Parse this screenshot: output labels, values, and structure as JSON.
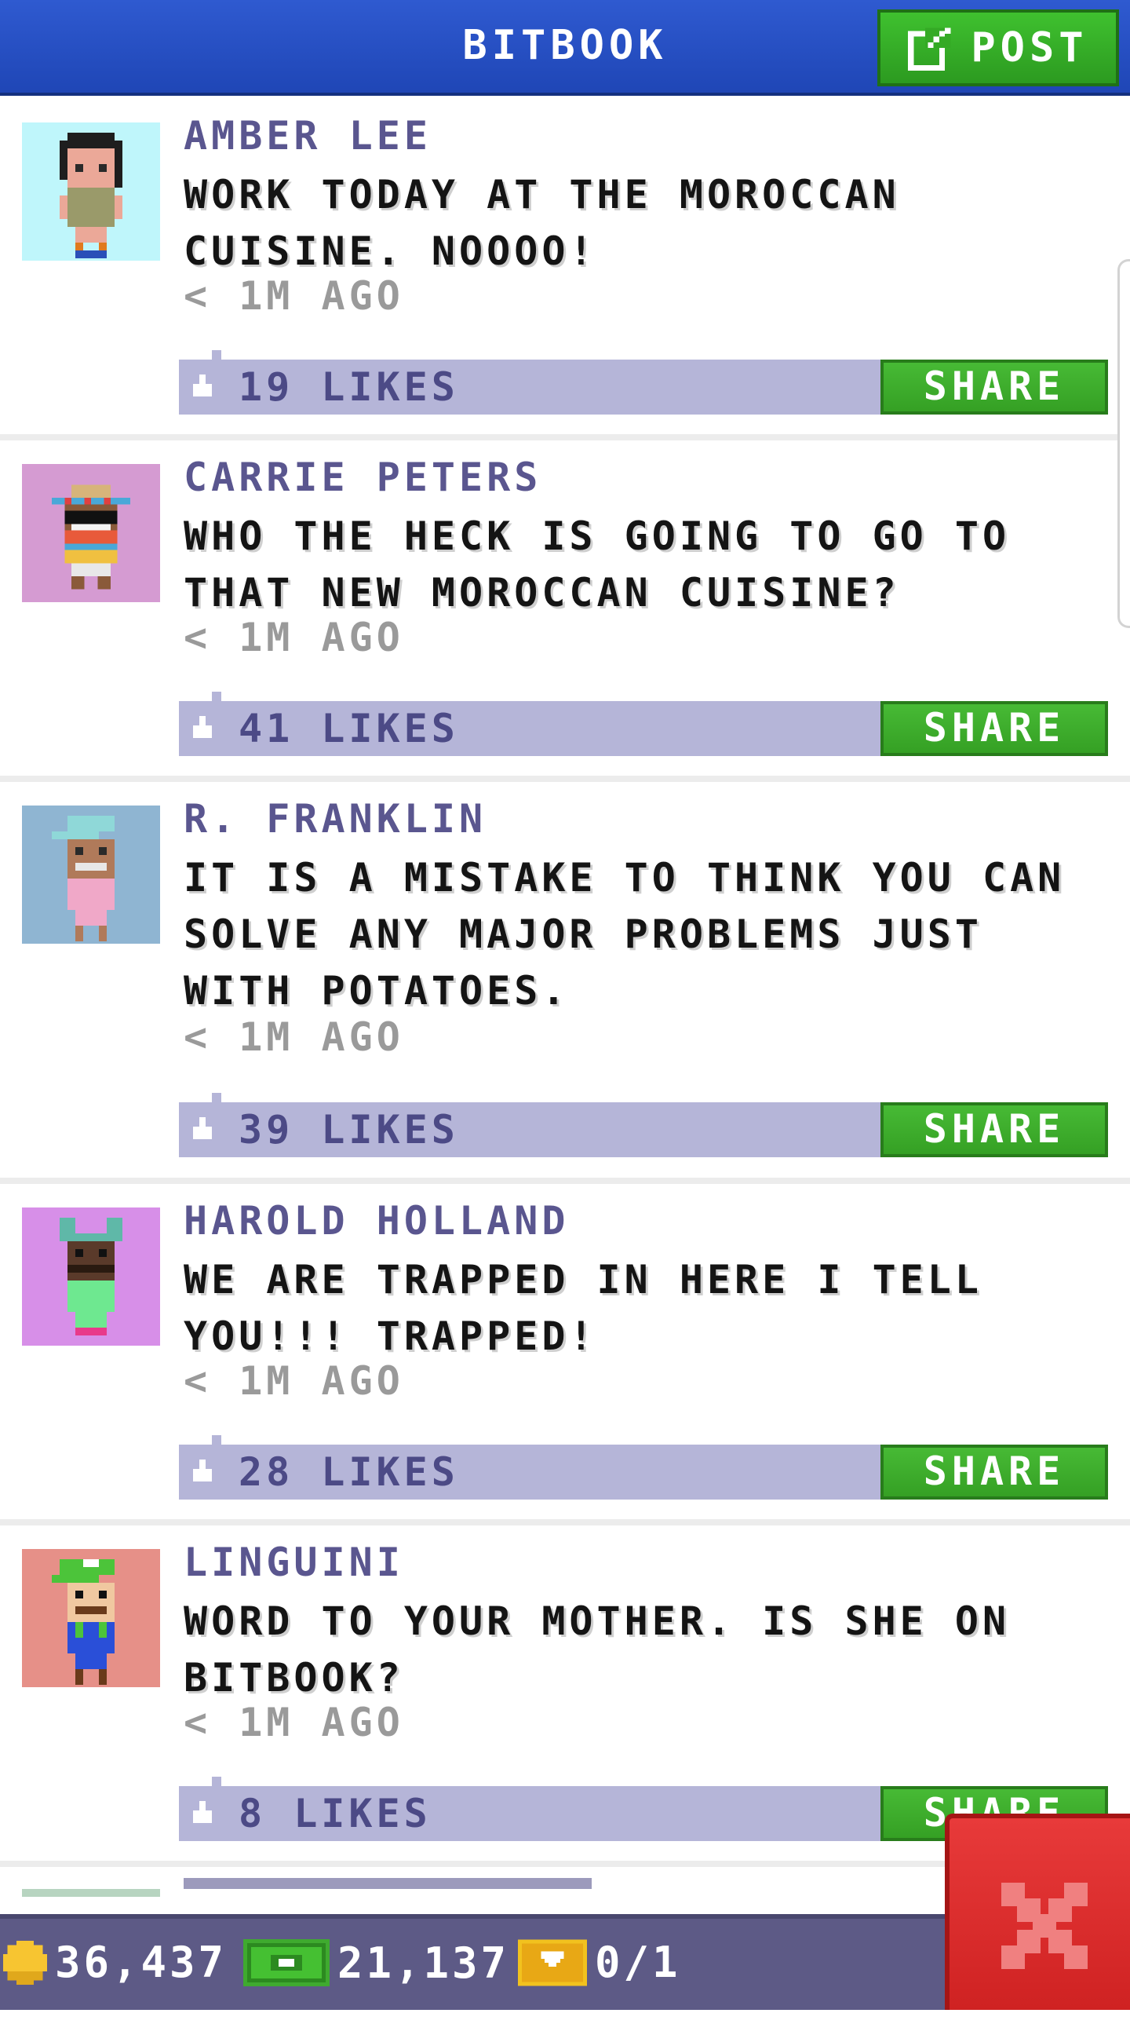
{
  "header": {
    "title": "BITBOOK",
    "post_label": "POST"
  },
  "posts": [
    {
      "name": "AMBER LEE",
      "text": "WORK TODAY AT THE MOROCCAN CUISINE. NOOOO!",
      "time": "< 1M AGO",
      "likes": "19 LIKES",
      "share_label": "SHARE",
      "avatar_bg": "#bff6fb"
    },
    {
      "name": "CARRIE PETERS",
      "text": "WHO THE HECK IS GOING TO GO TO THAT NEW MOROCCAN CUISINE?",
      "time": "< 1M AGO",
      "likes": "41 LIKES",
      "share_label": "SHARE",
      "avatar_bg": "#d59bd2"
    },
    {
      "name": "R. FRANKLIN",
      "text": "IT IS A MISTAKE TO THINK YOU CAN SOLVE ANY MAJOR PROBLEMS JUST WITH POTATOES.",
      "time": "< 1M AGO",
      "likes": "39 LIKES",
      "share_label": "SHARE",
      "avatar_bg": "#8fb5d2"
    },
    {
      "name": "HAROLD HOLLAND",
      "text": "WE ARE TRAPPED IN HERE I TELL YOU!!! TRAPPED!",
      "time": "< 1M AGO",
      "likes": "28 LIKES",
      "share_label": "SHARE",
      "avatar_bg": "#d78fe8"
    },
    {
      "name": "LINGUINI",
      "text": "WORD TO YOUR MOTHER. IS SHE ON BITBOOK?",
      "time": "< 1M AGO",
      "likes": "8 LIKES",
      "share_label": "SHARE",
      "avatar_bg": "#e69088"
    }
  ],
  "status": {
    "coins": "36,437",
    "bux": "21,137",
    "tickets": "0/1"
  },
  "colors": {
    "header_blue": "#2450c4",
    "post_green": "#3fb52f",
    "likes_bar": "#b5b5d8",
    "name_purple": "#5a568f",
    "close_red": "#dc2b2b",
    "bottom_bar": "#5d5a86"
  },
  "icons": {
    "post": "edit-icon",
    "like": "thumbs-up-icon",
    "coin": "coin-icon",
    "cash": "cash-icon",
    "ticket": "ticket-icon",
    "close": "close-icon"
  }
}
